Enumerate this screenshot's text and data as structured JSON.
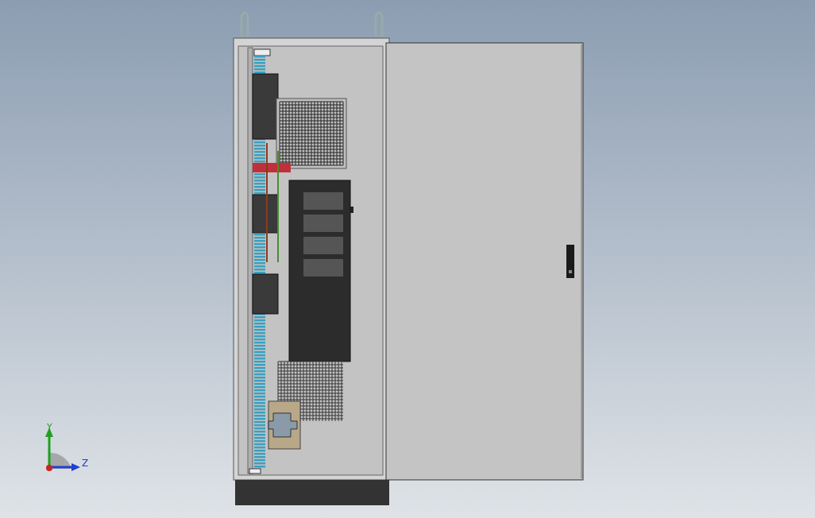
{
  "triad": {
    "y_label": "Y",
    "z_label": "Z"
  }
}
